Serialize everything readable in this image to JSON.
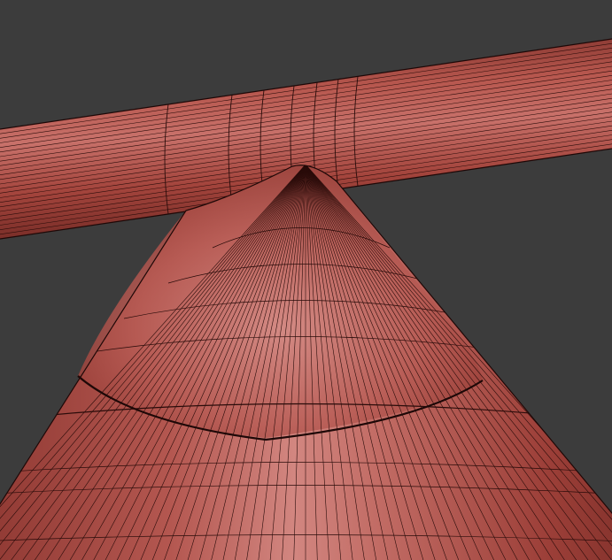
{
  "viewport": {
    "background": "#3c3c3c",
    "mesh_base_color": "#a8463e",
    "mesh_highlight_color": "#d98a84",
    "mesh_shadow_color": "#6e2a25",
    "wire_color": "#2a0c0a",
    "objects": [
      "horizontal-cylinder",
      "cone-with-blended-joint"
    ]
  }
}
